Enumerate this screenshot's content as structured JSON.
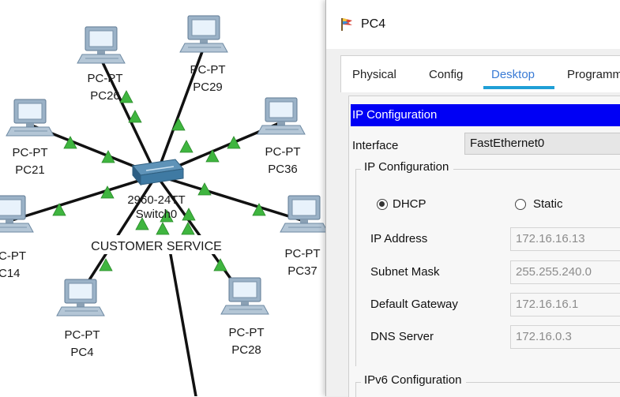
{
  "topology": {
    "switch": {
      "model": "2960-24TT",
      "name": "Switch0"
    },
    "room_label": "CUSTOMER SERVICE",
    "pcs": [
      {
        "type": "PC-PT",
        "name": "PC26"
      },
      {
        "type": "PC-PT",
        "name": "PC29"
      },
      {
        "type": "PC-PT",
        "name": "PC21"
      },
      {
        "type": "PC-PT",
        "name": "PC36"
      },
      {
        "type": "C-PT",
        "name": "C14"
      },
      {
        "type": "PC-PT",
        "name": "PC37"
      },
      {
        "type": "PC-PT",
        "name": "PC4"
      },
      {
        "type": "PC-PT",
        "name": "PC28"
      }
    ]
  },
  "window": {
    "title": "PC4",
    "tabs": [
      "Physical",
      "Config",
      "Desktop",
      "Programm"
    ],
    "active_tab": "Desktop",
    "section_header": "IP Configuration",
    "interface_label": "Interface",
    "interface_value": "FastEthernet0",
    "ip_group_title": "IP Configuration",
    "mode_options": {
      "dhcp": "DHCP",
      "static": "Static"
    },
    "selected_mode": "DHCP",
    "fields": [
      {
        "label": "IP Address",
        "value": "172.16.16.13"
      },
      {
        "label": "Subnet Mask",
        "value": "255.255.240.0"
      },
      {
        "label": "Default Gateway",
        "value": "172.16.16.1"
      },
      {
        "label": "DNS Server",
        "value": "172.16.0.3"
      }
    ],
    "ipv6_group_title": "IPv6 Configuration"
  },
  "colors": {
    "section_header_bg": "#0000f5",
    "active_tab_text": "#3a7bd5",
    "active_tab_underline": "#1f9fd6",
    "link_arrow": "#3fb53f"
  }
}
